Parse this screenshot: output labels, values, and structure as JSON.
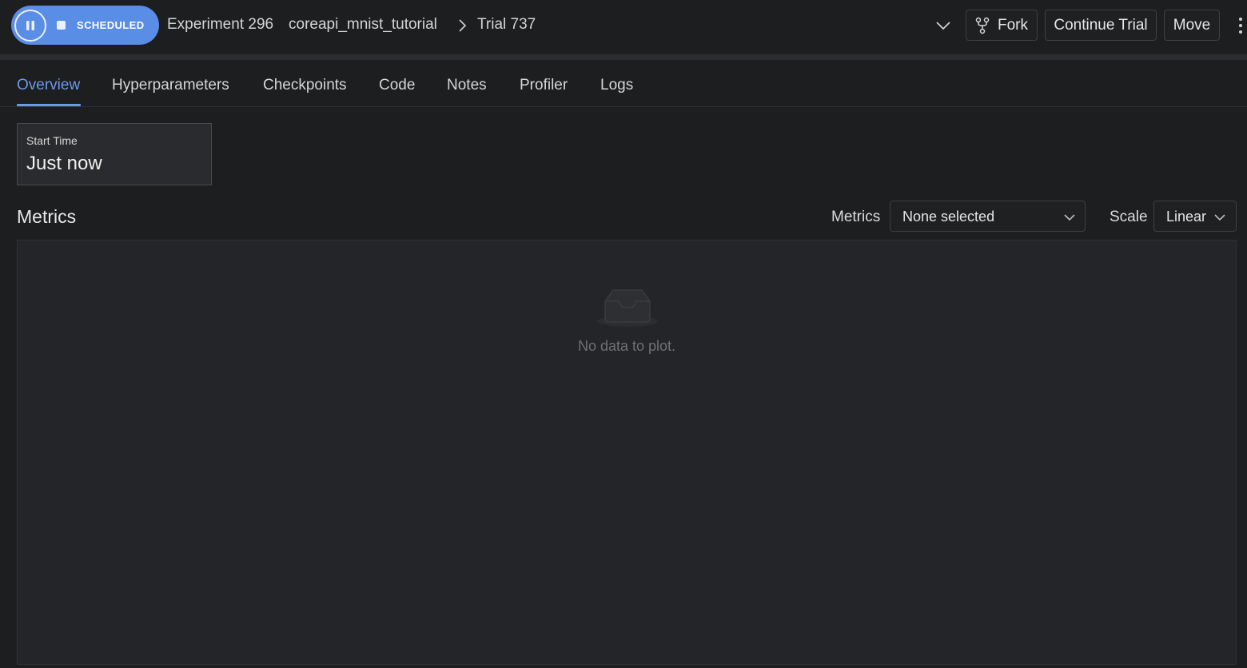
{
  "header": {
    "status": "SCHEDULED",
    "breadcrumb": {
      "experiment": "Experiment 296",
      "experiment_name": "coreapi_mnist_tutorial",
      "trial": "Trial 737"
    },
    "actions": {
      "fork": "Fork",
      "continue": "Continue Trial",
      "move": "Move"
    },
    "icons": [
      "pause-icon",
      "stop-icon",
      "chevron-right-icon",
      "chevron-down-icon",
      "fork-icon",
      "kebab-menu-icon"
    ]
  },
  "tabs": [
    {
      "label": "Overview",
      "active": true
    },
    {
      "label": "Hyperparameters",
      "active": false
    },
    {
      "label": "Checkpoints",
      "active": false
    },
    {
      "label": "Code",
      "active": false
    },
    {
      "label": "Notes",
      "active": false
    },
    {
      "label": "Profiler",
      "active": false
    },
    {
      "label": "Logs",
      "active": false
    }
  ],
  "start_time": {
    "label": "Start Time",
    "value": "Just now"
  },
  "metrics": {
    "title": "Metrics",
    "metrics_label": "Metrics",
    "metrics_value": "None selected",
    "scale_label": "Scale",
    "scale_value": "Linear",
    "empty_text": "No data to plot.",
    "empty_icon": "inbox-icon"
  },
  "colors": {
    "accent": "#5a8de6",
    "tab_active": "#6c98ea",
    "background": "#1d1e20",
    "panel": "#242528"
  }
}
